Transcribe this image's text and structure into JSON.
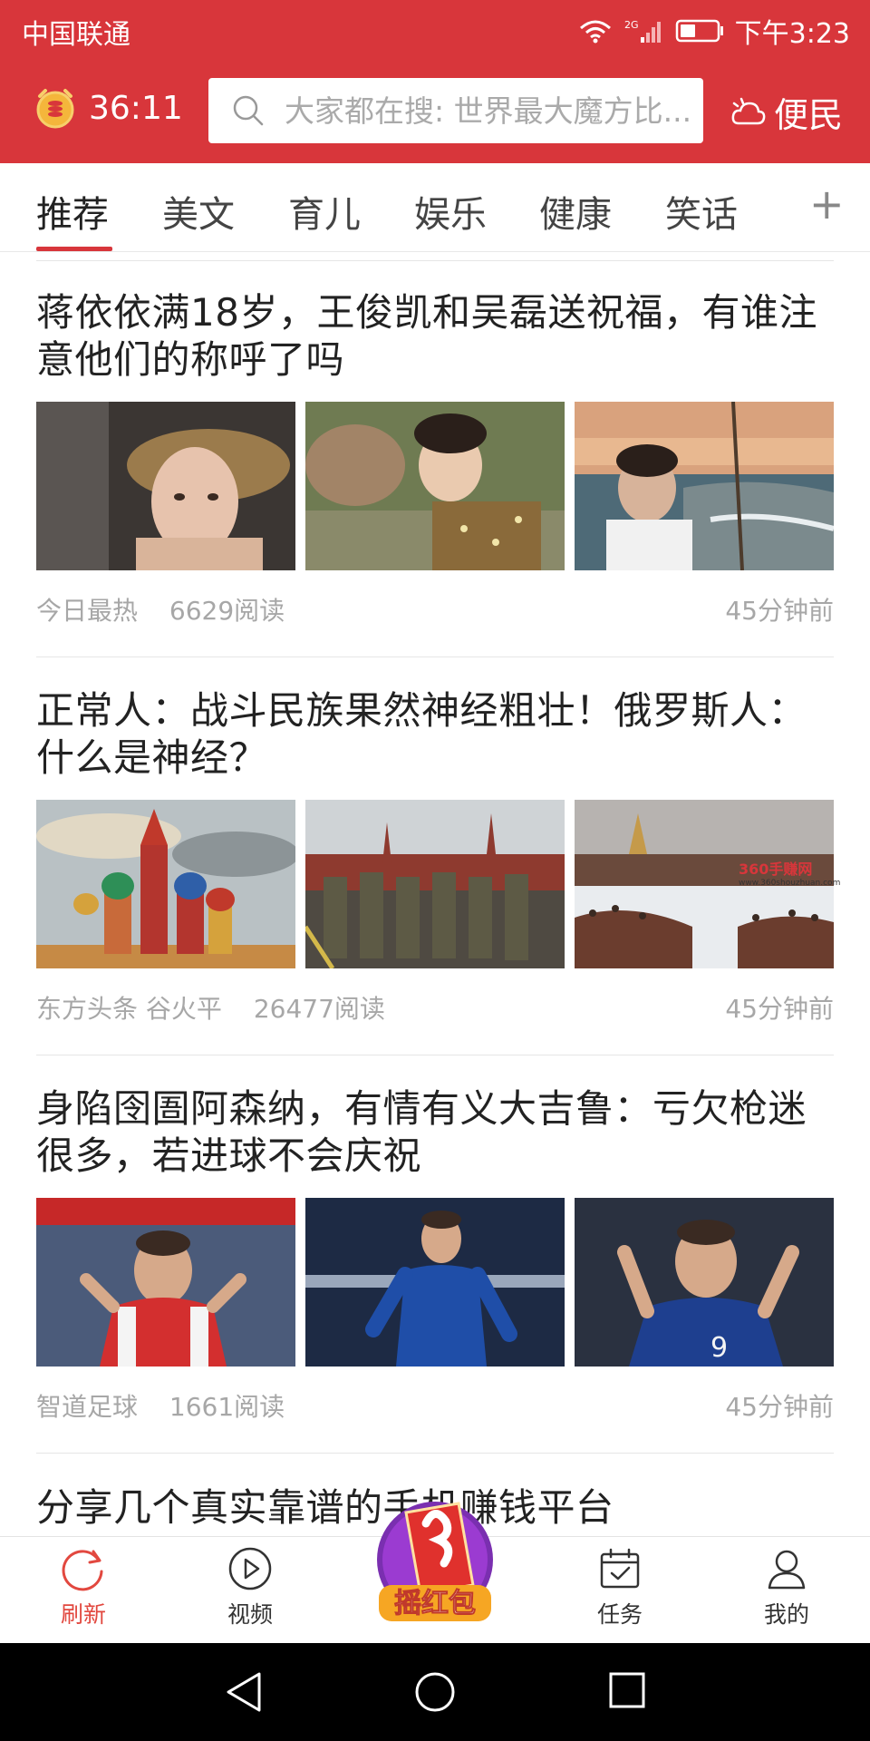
{
  "status_bar": {
    "carrier": "中国联通",
    "network": "2G",
    "time": "下午3:23"
  },
  "header": {
    "timer": "36:11",
    "search_placeholder": "大家都在搜: 世界最大魔方比...",
    "service_label": "便民",
    "colors": {
      "brand": "#d8363b"
    }
  },
  "tabs": {
    "items": [
      {
        "label": "推荐",
        "active": true
      },
      {
        "label": "美文"
      },
      {
        "label": "育儿"
      },
      {
        "label": "娱乐"
      },
      {
        "label": "健康"
      },
      {
        "label": "笑话"
      }
    ],
    "add_label": "+"
  },
  "articles": [
    {
      "title": "蒋依依满18岁，王俊凯和吴磊送祝福，有谁注意他们的称呼了吗",
      "source": "今日最热",
      "reads": "6629阅读",
      "time": "45分钟前",
      "images": [
        "girl-in-hat-photo",
        "boy-with-deer-photo",
        "boy-at-seaside-photo"
      ]
    },
    {
      "title": "正常人：战斗民族果然神经粗壮！俄罗斯人：什么是神经？",
      "source": "东方头条 谷火平",
      "reads": "26477阅读",
      "time": "45分钟前",
      "images": [
        "st-basils-cathedral-photo",
        "soldiers-marching-photo",
        "crowd-in-snow-photo"
      ]
    },
    {
      "title": "身陷囹圄阿森纳，有情有义大吉鲁：亏欠枪迷很多，若进球不会庆祝",
      "source": "智道足球",
      "reads": "1661阅读",
      "time": "45分钟前",
      "images": [
        "player-arsenal-photo",
        "player-chelsea-photo",
        "player-france-photo"
      ]
    },
    {
      "title": "分享几个真实靠谱的手机赚钱平台"
    }
  ],
  "watermark": {
    "title": "360手赚网",
    "url": "www.360shouzhuan.com"
  },
  "bottom_nav": {
    "items": [
      {
        "label": "刷新",
        "icon": "refresh-icon",
        "active": true
      },
      {
        "label": "视频",
        "icon": "play-icon"
      },
      {
        "label": "任务",
        "icon": "calendar-check-icon"
      },
      {
        "label": "我的",
        "icon": "user-icon"
      }
    ],
    "shake_label": "摇红包"
  }
}
